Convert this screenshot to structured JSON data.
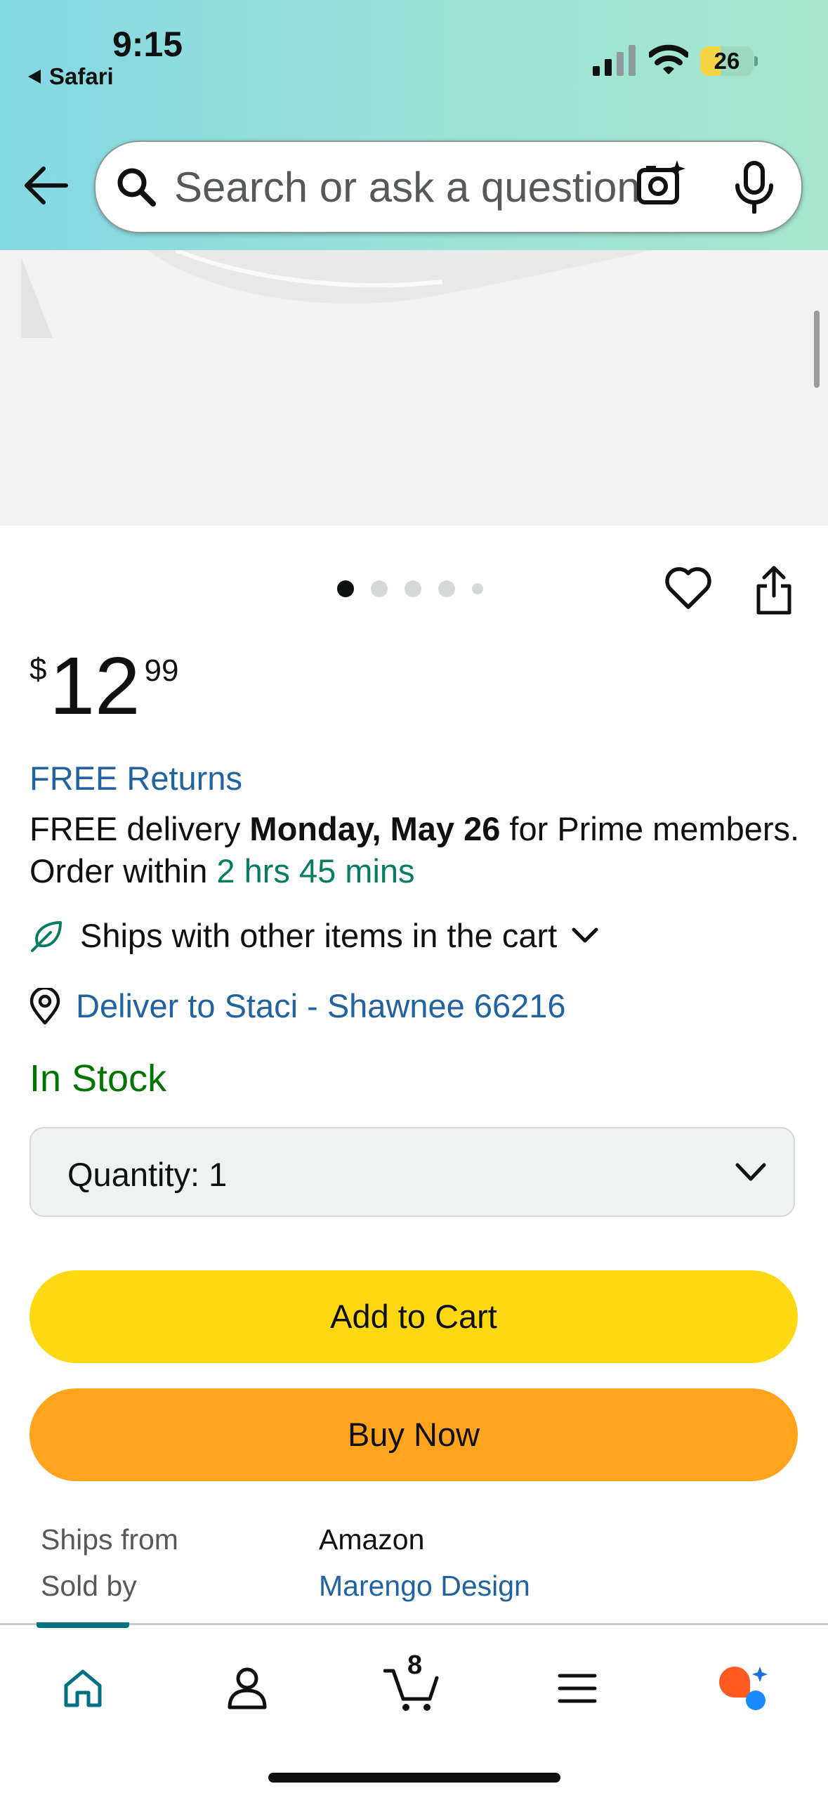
{
  "status_bar": {
    "time": "9:15",
    "back_app": "Safari",
    "battery": "26"
  },
  "search": {
    "placeholder": "Search or ask a question"
  },
  "product": {
    "price_symbol": "$",
    "price_whole": "12",
    "price_fraction": "99",
    "image_page_count": 5,
    "image_page_active": 1
  },
  "delivery": {
    "free_returns": "FREE Returns",
    "prefix": "FREE delivery ",
    "date": "Monday, May 26",
    "suffix": " for Prime members. Order within ",
    "countdown": "2 hrs 45 mins",
    "ships_with": "Ships with other items in the cart",
    "deliver_to": "Deliver to Staci - Shawnee 66216"
  },
  "stock": "In Stock",
  "quantity": {
    "label": "Quantity:",
    "value": "1"
  },
  "buttons": {
    "add_to_cart": "Add to Cart",
    "buy_now": "Buy Now"
  },
  "seller_info": {
    "ships_from_label": "Ships from",
    "ships_from_value": "Amazon",
    "sold_by_label": "Sold by",
    "sold_by_value": "Marengo Design"
  },
  "nav": {
    "cart_count": "8",
    "items": [
      "home-icon",
      "account-icon",
      "cart-icon",
      "menu-icon",
      "rufus-icon"
    ]
  },
  "colors": {
    "link": "#2162A1",
    "in_stock": "#007600",
    "countdown": "#067D62",
    "add_to_cart": "#FFD814",
    "buy_now": "#FFA41C",
    "nav_active": "#007185"
  }
}
